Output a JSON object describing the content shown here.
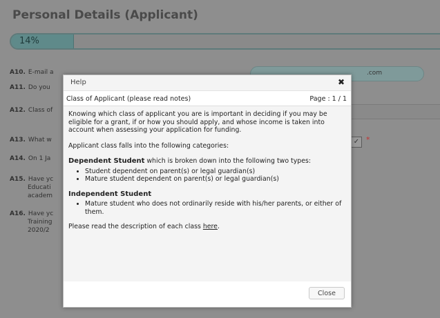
{
  "page": {
    "title": "Personal Details (Applicant)",
    "progress": {
      "label": "14%",
      "value": 0.14
    }
  },
  "questions": [
    {
      "num": "A10.",
      "text": "E-mail a"
    },
    {
      "num": "A11.",
      "text": "Do you"
    },
    {
      "num": "A12.",
      "text": "Class of"
    },
    {
      "num": "A13.",
      "text": "What w"
    },
    {
      "num": "A14.",
      "text": "On 1 Ja"
    },
    {
      "num": "A15.",
      "line1": "Have yc",
      "line2": "Educati",
      "line3": "academ"
    },
    {
      "num": "A16.",
      "line1": "Have yc",
      "line2": "Training",
      "line3": "2020/2"
    }
  ],
  "background": {
    "email_fragment": ".com",
    "required_marker": "*",
    "check_glyph": "✓"
  },
  "modal": {
    "title": "Help",
    "close_glyph": "✖",
    "subtitle": "Class of Applicant (please read notes)",
    "page_indicator": "Page : 1 / 1",
    "para1": "Knowing which class of applicant you are is important in deciding if you may be eligible for a grant, if or how you should apply, and whose income is taken into account when assessing your application for funding.",
    "para2": "Applicant class falls into the following categories:",
    "dependent": {
      "heading": "Dependent Student",
      "rest": " which is broken down into the following two types:",
      "items": [
        "Student dependent on parent(s) or legal guardian(s)",
        "Mature student dependent on parent(s) or legal guardian(s)"
      ]
    },
    "independent": {
      "heading": "Independent Student",
      "items": [
        "Mature student who does not ordinarily reside with his/her parents, or either of them."
      ]
    },
    "footer_text": "Please read the description of each class ",
    "link_text": "here",
    "footer_end": ".",
    "close_button": "Close"
  }
}
